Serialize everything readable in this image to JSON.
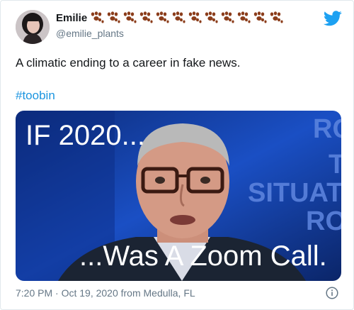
{
  "tweet": {
    "author_name": "Emilie",
    "author_handle": "@emilie_plants",
    "text": "A climatic ending to a career in fake news.",
    "hashtag": "#toobin",
    "timestamp": "7:20 PM · Oct 19, 2020 from Medulla, FL",
    "emoji": "paw-prints",
    "emoji_count": 12
  },
  "media": {
    "caption_top": "IF 2020...",
    "caption_bottom": "...Was A Zoom Call.",
    "background_text": [
      "RO",
      "T",
      "SITUATI",
      "RO"
    ]
  },
  "icons": {
    "brand": "twitter-bird-icon",
    "info": "info-icon"
  },
  "colors": {
    "brand_blue": "#1da1f2",
    "link_blue": "#1b95e0",
    "paw_brown": "#8b3d1b"
  }
}
